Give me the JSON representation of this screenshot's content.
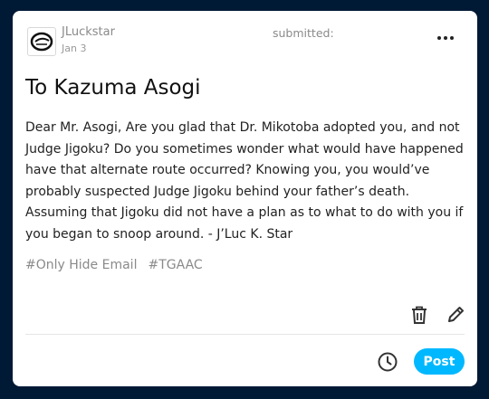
{
  "post": {
    "username": "JLuckstar",
    "date": "Jan 3",
    "status": "submitted:",
    "title": "To Kazuma Asogi",
    "body": "Dear Mr. Asogi,  Are you glad that Dr. Mikotoba adopted you, and not Judge Jigoku? Do you sometimes wonder what would have happened have that alternate route occurred?   Knowing you, you would’ve probably suspected Judge Jigoku behind your father’s death. Assuming that Jigoku did not have a plan as to what to do with you if you began to snoop around.  - J’Luc K. Star",
    "tags": [
      "#Only Hide Email",
      "#TGAAC"
    ]
  },
  "actions": {
    "post_label": "Post",
    "more_icon": "more-dots-icon",
    "delete_icon": "trash-icon",
    "edit_icon": "pencil-icon",
    "schedule_icon": "clock-icon"
  },
  "colors": {
    "background": "#001935",
    "accent": "#00b8ff"
  }
}
